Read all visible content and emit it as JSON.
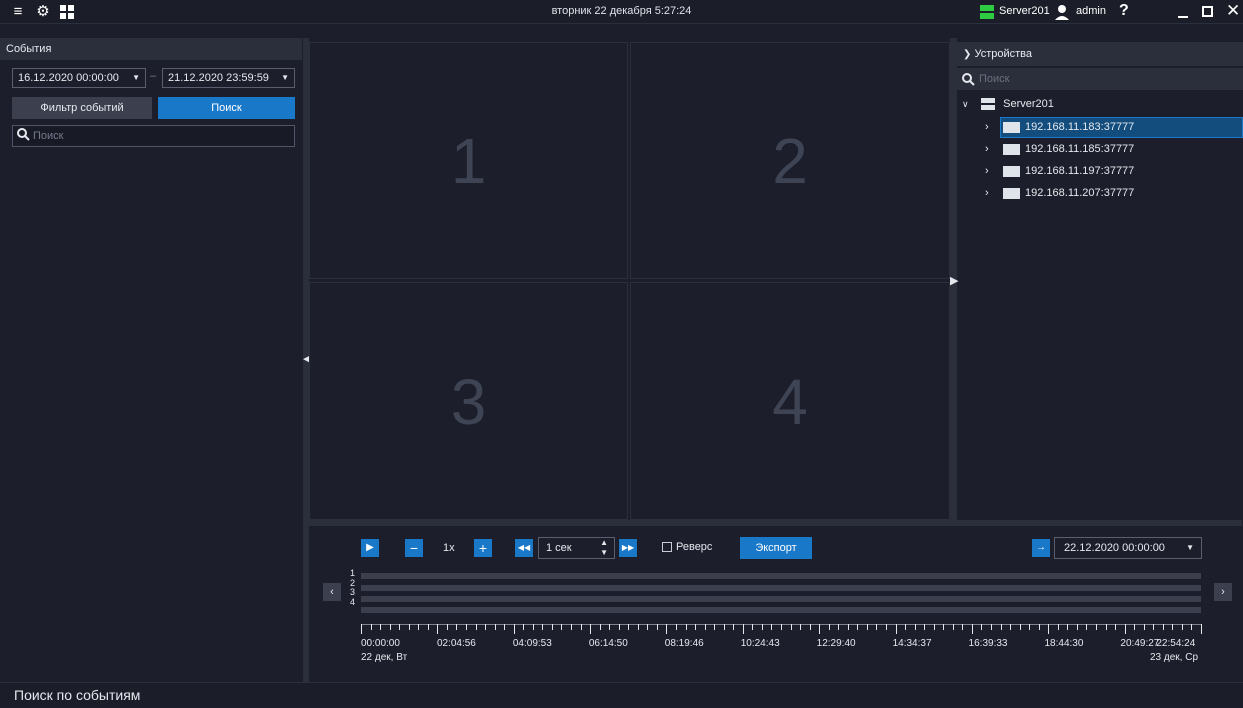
{
  "topbar": {
    "datetime": "вторник 22 декабря 5:27:24",
    "server": "Server201",
    "user": "admin",
    "help": "?",
    "icons": [
      "menu-icon",
      "gear-icon",
      "layout-icon",
      "server-icon",
      "user-icon",
      "minimize-icon",
      "maximize-icon",
      "close-icon"
    ],
    "status_color": "#2ecc40"
  },
  "events": {
    "title": "События",
    "date_from": "16.12.2020  00:00:00",
    "date_sep": "–",
    "date_to": "21.12.2020  23:59:59",
    "filter_label": "Фильтр событий",
    "search_label": "Поиск",
    "search_placeholder": "Поиск"
  },
  "grid": {
    "tiles": [
      "1",
      "2",
      "3",
      "4"
    ]
  },
  "devices": {
    "title": "Устройства",
    "search_placeholder": "Поиск",
    "server": "Server201",
    "cameras": [
      "192.168.11.183:37777",
      "192.168.11.185:37777",
      "192.168.11.197:37777",
      "192.168.11.207:37777"
    ],
    "selected_index": 0
  },
  "playback": {
    "speed": "1x",
    "step": "1 сек",
    "reverse_label": "Реверс",
    "export_label": "Экспорт",
    "goto_datetime": "22.12.2020  00:00:00",
    "tracks": [
      "1",
      "2",
      "3",
      "4"
    ],
    "time_labels": [
      "00:00:00",
      "02:04:56",
      "04:09:53",
      "06:14:50",
      "08:19:46",
      "10:24:43",
      "12:29:40",
      "14:34:37",
      "16:39:33",
      "18:44:30",
      "20:49:27",
      "22:54:24"
    ],
    "date_start": "22 дек, Вт",
    "date_end": "23 дек, Ср",
    "accent": "#1a78c9"
  },
  "status": {
    "text": "Поиск по событиям"
  }
}
